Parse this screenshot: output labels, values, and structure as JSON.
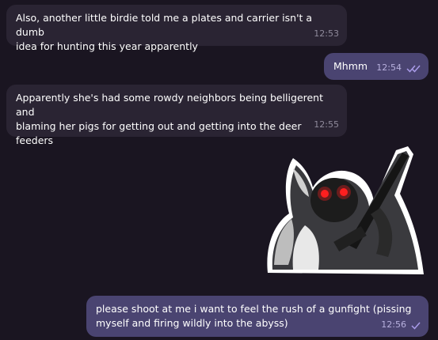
{
  "messages": [
    {
      "id": "m1",
      "direction": "incoming",
      "text": "Also, another little birdie told me a plates and carrier isn't a dumb\nidea for hunting this year apparently",
      "time": "12:53"
    },
    {
      "id": "m2",
      "direction": "outgoing",
      "text": "Mhmm",
      "time": "12:54",
      "status": "read"
    },
    {
      "id": "m3",
      "direction": "incoming",
      "text": "Apparently she's had some rowdy neighbors being belligerent and\nblaming her pigs for getting out and getting into the deer feeders",
      "time": "12:55"
    },
    {
      "id": "m4",
      "direction": "outgoing",
      "type": "sticker",
      "sticker_icon": "armed-creature-sticker"
    },
    {
      "id": "m5",
      "direction": "outgoing",
      "text": "please shoot at me i want to feel the rush of a gunfight (pissing\nmyself and firing wildly into the abyss)",
      "time": "12:56",
      "status": "sent"
    }
  ],
  "colors": {
    "background": "#1a1521",
    "incoming_bubble": "#2a2433",
    "outgoing_bubble": "#4a4471",
    "check": "#a99be8",
    "sticker_eyes": "#ff2020"
  }
}
